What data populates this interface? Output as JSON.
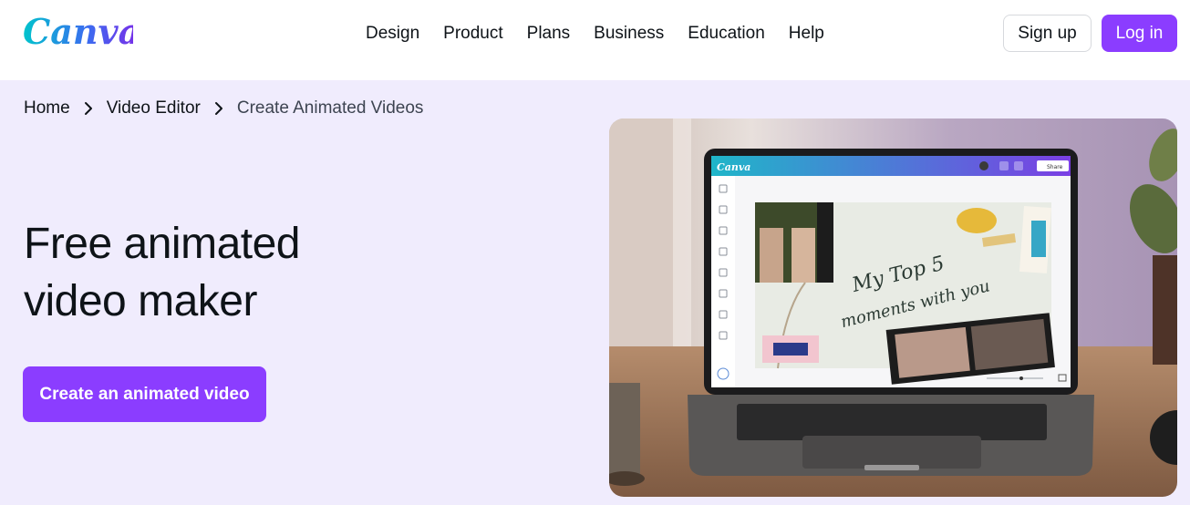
{
  "header": {
    "logo_text": "Canva",
    "nav": [
      {
        "label": "Design"
      },
      {
        "label": "Product"
      },
      {
        "label": "Plans"
      },
      {
        "label": "Business"
      },
      {
        "label": "Education"
      },
      {
        "label": "Help"
      }
    ],
    "signup_label": "Sign up",
    "login_label": "Log in"
  },
  "breadcrumb": {
    "items": [
      {
        "label": "Home"
      },
      {
        "label": "Video Editor"
      },
      {
        "label": "Create Animated Videos"
      }
    ]
  },
  "hero": {
    "title_line1": "Free animated",
    "title_line2": "video maker",
    "cta_label": "Create an animated video"
  },
  "editor_mock": {
    "app_logo": "Canva",
    "share_label": "Share",
    "canvas_text_line1": "My Top 5",
    "canvas_text_line2": "moments with you"
  },
  "colors": {
    "brand": "#8b3dff",
    "hero_bg": "#f0ecfd",
    "logo_gradient_start": "#00c4cc",
    "logo_gradient_end": "#7d2ae8"
  }
}
